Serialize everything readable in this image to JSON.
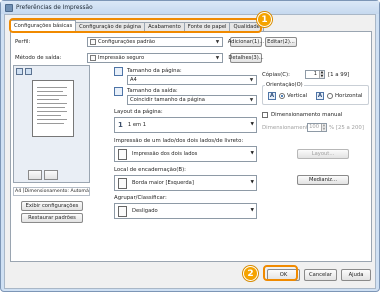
{
  "window": {
    "title": "Preferências de Impressão"
  },
  "tabs": [
    {
      "label": "Configurações básicas",
      "active": true
    },
    {
      "label": "Configuração de página"
    },
    {
      "label": "Acabamento"
    },
    {
      "label": "Fonte de papel"
    },
    {
      "label": "Qualidade"
    }
  ],
  "callouts": {
    "one": "1",
    "two": "2"
  },
  "profile": {
    "label": "Perfil:",
    "value": "Configurações padrão",
    "add_label": "Adicionar(1)...",
    "edit_label": "Editar(2)..."
  },
  "output": {
    "label": "Método de saída:",
    "value": "Impressão seguro",
    "details_label": "Detalhes(3)..."
  },
  "preview": {
    "status": "A4 [Dimensionamento: Automático]",
    "view_settings_label": "Exibir configurações",
    "restore_defaults_label": "Restaurar padrões"
  },
  "page_size": {
    "label": "Tamanho da página:",
    "value": "A4"
  },
  "output_size": {
    "label": "Tamanho da saída:",
    "value": "Coincidir tamanho da página"
  },
  "layout": {
    "label": "Layout da página:",
    "value": "1 em 1"
  },
  "duplex": {
    "label": "Impressão de um lado/dos dois lados/de livreto:",
    "value": "Impressão dos dois lados"
  },
  "binding": {
    "label": "Local de encadernação(B):",
    "value": "Borda maior [Esquerda]",
    "margin_label": "Medianiz..."
  },
  "collate": {
    "label": "Agrupar/Classificar:",
    "value": "Desligado"
  },
  "copies": {
    "label": "Cópias(C):",
    "value": "1",
    "range": "[1 a 99]"
  },
  "orientation": {
    "label": "Orientação(O)",
    "portrait": "Vertical",
    "landscape": "Horizontal",
    "selected": "portrait"
  },
  "scaling": {
    "manual_label": "Dimensionamento manual",
    "field_label": "Dimensionamento:",
    "value": "100",
    "range": "% [25 a 200]"
  },
  "watermark": {
    "label": "Layout..."
  },
  "footer": {
    "ok": "OK",
    "cancel": "Cancelar",
    "help": "Ajuda"
  }
}
